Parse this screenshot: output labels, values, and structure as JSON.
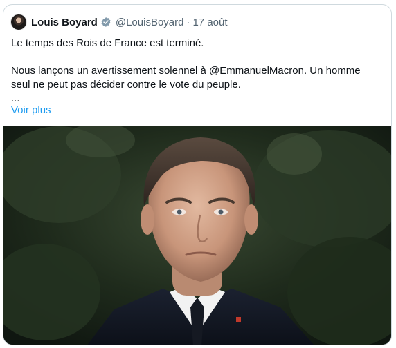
{
  "tweet": {
    "author_name": "Louis Boyard",
    "handle": "@LouisBoyard",
    "separator": "·",
    "date": "17 août",
    "text_line1": "Le temps des Rois de France est terminé.",
    "text_line2_prefix": "Nous lançons un avertissement solennel à ",
    "text_line2_mention": "@EmmanuelMacron",
    "text_line2_suffix": ". Un homme",
    "text_line3": "seul ne peut pas décider contre le vote du peuple.",
    "text_line4": "...",
    "show_more_label": "Voir plus"
  },
  "icons": {
    "avatar": "profile-avatar",
    "verified": "verified-badge-icon"
  },
  "colors": {
    "link": "#1d9bf0",
    "secondary_text": "#536471",
    "primary_text": "#0f1419",
    "verified_badge": "#829aab",
    "border": "#cfd9de"
  }
}
